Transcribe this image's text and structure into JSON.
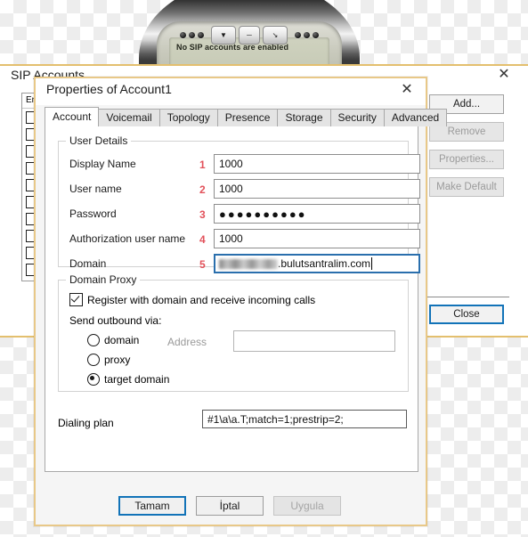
{
  "phone": {
    "lcd_text": "No SIP accounts are enabled",
    "keys": [
      "▼",
      "─",
      "↘"
    ]
  },
  "sip_window": {
    "title": "SIP Accounts",
    "close_icon": "✕",
    "list_header": "En",
    "row_count": 10,
    "buttons": [
      {
        "label": "Add...",
        "enabled": true
      },
      {
        "label": "Remove",
        "enabled": false
      },
      {
        "label": "Properties...",
        "enabled": false
      },
      {
        "label": "Make Default",
        "enabled": false
      }
    ],
    "close_button": "Close"
  },
  "dialog": {
    "title": "Properties of Account1",
    "close_icon": "✕",
    "tabs": [
      {
        "label": "Account",
        "active": true
      },
      {
        "label": "Voicemail",
        "active": false
      },
      {
        "label": "Topology",
        "active": false
      },
      {
        "label": "Presence",
        "active": false
      },
      {
        "label": "Storage",
        "active": false
      },
      {
        "label": "Security",
        "active": false
      },
      {
        "label": "Advanced",
        "active": false
      }
    ],
    "user_details": {
      "title": "User Details",
      "fields": [
        {
          "label": "Display Name",
          "num": "1",
          "value": "1000"
        },
        {
          "label": "User name",
          "num": "2",
          "value": "1000"
        },
        {
          "label": "Password",
          "num": "3",
          "value": "●●●●●●●●●●"
        },
        {
          "label": "Authorization user name",
          "num": "4",
          "value": "1000"
        },
        {
          "label": "Domain",
          "num": "5",
          "value": ".bulutsantralim.com"
        }
      ]
    },
    "domain_proxy": {
      "title": "Domain Proxy",
      "register_label": "Register with domain and receive incoming calls",
      "register_checked": true,
      "send_outbound_label": "Send outbound via:",
      "options": [
        {
          "label": "domain",
          "selected": false
        },
        {
          "label": "proxy",
          "selected": false
        },
        {
          "label": "target domain",
          "selected": true
        }
      ],
      "address_label": "Address",
      "address_value": "",
      "address_placeholder": ""
    },
    "dialing_plan": {
      "label": "Dialing plan",
      "value": "#1\\a\\a.T;match=1;prestrip=2;"
    },
    "buttons": [
      {
        "label": "Tamam",
        "style": "primary"
      },
      {
        "label": "İptal",
        "style": "normal"
      },
      {
        "label": "Uygula",
        "style": "disabled"
      }
    ]
  },
  "colors": {
    "accent_blue": "#1273b8",
    "dialog_border_gold": "#e8c888",
    "marker_red": "#e2515a"
  }
}
